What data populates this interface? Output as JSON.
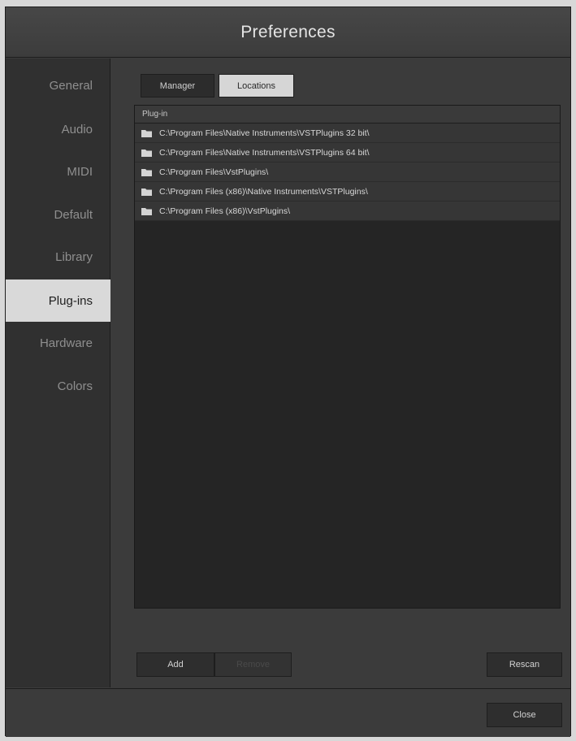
{
  "window": {
    "title": "Preferences"
  },
  "sidebar": {
    "items": [
      {
        "label": "General"
      },
      {
        "label": "Audio"
      },
      {
        "label": "MIDI"
      },
      {
        "label": "Default"
      },
      {
        "label": "Library"
      },
      {
        "label": "Plug-ins",
        "active": true
      },
      {
        "label": "Hardware"
      },
      {
        "label": "Colors"
      }
    ]
  },
  "tabs": {
    "manager": "Manager",
    "locations": "Locations",
    "selected": "Locations"
  },
  "list": {
    "header": "Plug-in",
    "rows": [
      {
        "icon": "folder-icon",
        "path": "C:\\Program Files\\Native Instruments\\VSTPlugins 32 bit\\"
      },
      {
        "icon": "folder-icon",
        "path": "C:\\Program Files\\Native Instruments\\VSTPlugins 64 bit\\"
      },
      {
        "icon": "folder-icon",
        "path": "C:\\Program Files\\VstPlugins\\"
      },
      {
        "icon": "folder-icon",
        "path": "C:\\Program Files (x86)\\Native Instruments\\VSTPlugins\\"
      },
      {
        "icon": "folder-icon",
        "path": "C:\\Program Files (x86)\\VstPlugins\\"
      }
    ]
  },
  "buttons": {
    "add": "Add",
    "remove": "Remove",
    "rescan": "Rescan",
    "close": "Close"
  },
  "colors": {
    "active_tab": "#d6d6d6",
    "window_bg": "#3b3b3b",
    "list_bg": "#252525"
  }
}
